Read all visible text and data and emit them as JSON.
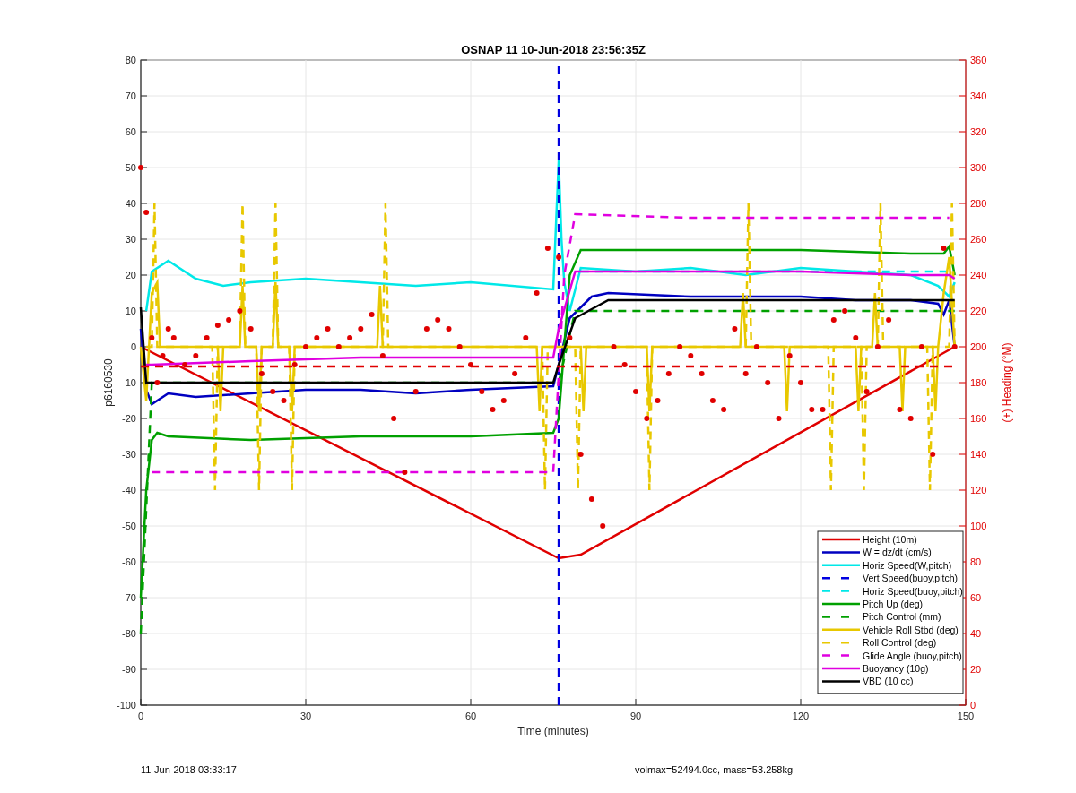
{
  "figure": {
    "chart_data": {
      "type": "line",
      "title": "OSNAP 11 10-Jun-2018 23:56:35Z",
      "xlabel": "Time (minutes)",
      "ylabel": "p6160530",
      "y2label": "(+) Heading (°M)",
      "grid": true,
      "legend": true,
      "xlim": [
        0,
        150
      ],
      "ylim": [
        -100,
        80
      ],
      "y2lim": [
        0,
        360
      ],
      "xticks": [
        0,
        30,
        60,
        90,
        120,
        150
      ],
      "yticks": [
        -100,
        -90,
        -80,
        -70,
        -60,
        -50,
        -40,
        -30,
        -20,
        -10,
        0,
        10,
        20,
        30,
        40,
        50,
        60,
        70,
        80
      ],
      "y2ticks": [
        0,
        20,
        40,
        60,
        80,
        100,
        120,
        140,
        160,
        180,
        200,
        220,
        240,
        260,
        280,
        300,
        320,
        340,
        360
      ],
      "series": [
        {
          "name": "Height (10m)",
          "color": "#e00000",
          "line_style": "solid",
          "x": [
            0,
            76,
            80,
            148
          ],
          "values": [
            0,
            -59,
            -58,
            0
          ]
        },
        {
          "name": "W = dz/dt (cm/s)",
          "color": "#0000c0",
          "line_style": "solid",
          "x": [
            0,
            1,
            2,
            5,
            10,
            20,
            30,
            40,
            50,
            60,
            75,
            76,
            78,
            82,
            85,
            100,
            120,
            130,
            140,
            145,
            146,
            147,
            148
          ],
          "values": [
            5,
            -12,
            -16,
            -13,
            -14,
            -13,
            -12,
            -12,
            -13,
            -12,
            -11,
            -5,
            8,
            14,
            15,
            14,
            14,
            13,
            13,
            12,
            9,
            13,
            0
          ]
        },
        {
          "name": "Horiz Speed(W,pitch)",
          "color": "#00e8e8",
          "line_style": "solid",
          "x": [
            1,
            2,
            5,
            10,
            15,
            20,
            30,
            40,
            50,
            60,
            75,
            76,
            76.5,
            77,
            78,
            80,
            90,
            100,
            110,
            120,
            130,
            140,
            145,
            147,
            148
          ],
          "values": [
            10,
            21,
            24,
            19,
            17,
            18,
            19,
            18,
            17,
            18,
            16,
            52,
            30,
            18,
            10,
            22,
            21,
            22,
            20,
            22,
            21,
            20,
            17,
            14,
            18
          ]
        },
        {
          "name": "Vert Speed(buoy,pitch)",
          "color": "#0000e0",
          "line_style": "dashed",
          "x": [
            76,
            76
          ],
          "values": [
            -100,
            80
          ]
        },
        {
          "name": "Horiz Speed(buoy,pitch)",
          "color": "#00e8e8",
          "line_style": "dashed",
          "x": [
            80,
            147
          ],
          "values": [
            21,
            21
          ]
        },
        {
          "name": "Pitch Up (deg)",
          "color": "#00a000",
          "line_style": "solid",
          "x": [
            0,
            1,
            2,
            3,
            5,
            20,
            40,
            60,
            75,
            76,
            78,
            80,
            90,
            100,
            120,
            140,
            146,
            147,
            148
          ],
          "values": [
            -70,
            -40,
            -26,
            -24,
            -25,
            -26,
            -25,
            -25,
            -24,
            -20,
            20,
            27,
            27,
            27,
            27,
            26,
            26,
            28,
            20
          ]
        },
        {
          "name": "Pitch Control (mm)",
          "color": "#00a000",
          "line_style": "dashed",
          "x": [
            0,
            2,
            75,
            76,
            79,
            147,
            148
          ],
          "values": [
            -80,
            -10,
            -10,
            -10,
            10,
            10,
            10
          ]
        },
        {
          "name": "Vehicle Roll Stbd (deg)",
          "color": "#e8c800",
          "line_style": "solid",
          "x": [
            0,
            1,
            2,
            3,
            3.5,
            4,
            10,
            14,
            14.5,
            15,
            18,
            18.5,
            19,
            21,
            21.5,
            22,
            24,
            24.5,
            25,
            27,
            27.5,
            28,
            43,
            43.5,
            44,
            50,
            70,
            72,
            72.5,
            73,
            76,
            78,
            80,
            80.5,
            81,
            86,
            86.5,
            87,
            92,
            92.5,
            93,
            109,
            109.5,
            110,
            117,
            117.5,
            118,
            130,
            130.5,
            131,
            133,
            133.5,
            134,
            138,
            138.5,
            139,
            144,
            144.5,
            145,
            146,
            147,
            148
          ],
          "values": [
            0,
            -15,
            15,
            18,
            0,
            0,
            0,
            0,
            -18,
            0,
            0,
            17,
            0,
            0,
            -18,
            0,
            0,
            18,
            0,
            0,
            -18,
            0,
            0,
            17,
            0,
            0,
            0,
            0,
            -18,
            0,
            0,
            0,
            0,
            -18,
            0,
            0,
            0,
            0,
            0,
            -18,
            0,
            0,
            15,
            0,
            0,
            -18,
            0,
            0,
            -18,
            0,
            0,
            15,
            0,
            0,
            -18,
            0,
            0,
            -18,
            0,
            15,
            25,
            0
          ]
        },
        {
          "name": "Roll Control (deg)",
          "color": "#e8c800",
          "line_style": "dashed",
          "x": [
            1,
            2,
            2.5,
            3,
            13,
            13.5,
            14,
            18,
            18.5,
            19,
            21,
            21.5,
            22,
            24,
            24.5,
            25,
            27,
            27.5,
            28,
            44,
            44.5,
            45,
            73,
            73.5,
            74,
            79,
            79.5,
            80,
            92,
            92.5,
            93,
            110,
            110.5,
            111,
            125,
            125.5,
            126,
            131,
            131.5,
            132,
            134,
            134.5,
            135,
            143,
            143.5,
            144,
            147,
            147.5,
            148
          ],
          "values": [
            0,
            0,
            40,
            0,
            0,
            -40,
            0,
            0,
            40,
            0,
            0,
            -40,
            0,
            0,
            40,
            0,
            0,
            -40,
            0,
            0,
            40,
            0,
            0,
            -40,
            0,
            0,
            -40,
            0,
            0,
            -40,
            0,
            0,
            40,
            0,
            0,
            -40,
            0,
            0,
            -40,
            0,
            0,
            40,
            0,
            0,
            -40,
            0,
            0,
            40,
            0
          ]
        },
        {
          "name": "Glide Angle (buoy,pitch)",
          "color": "#e000e0",
          "line_style": "dashed",
          "x": [
            2,
            20,
            40,
            60,
            75,
            77,
            79,
            100,
            120,
            140,
            147
          ],
          "values": [
            -35,
            -35,
            -35,
            -35,
            -35,
            20,
            37,
            36,
            36,
            36,
            36
          ]
        },
        {
          "name": "Buoyancy (10g)",
          "color": "#e000e0",
          "line_style": "solid",
          "x": [
            1,
            2,
            20,
            40,
            60,
            75,
            76,
            79,
            100,
            120,
            140,
            147,
            148
          ],
          "values": [
            -5,
            -5,
            -4,
            -3,
            -3,
            -3,
            5,
            21,
            21,
            21,
            20,
            20,
            19
          ]
        },
        {
          "name": "VBD (10 cc)",
          "color": "#000000",
          "line_style": "solid",
          "x": [
            0,
            1,
            75,
            76,
            79,
            85,
            100,
            148
          ],
          "values": [
            11,
            -10,
            -10,
            -5,
            8,
            13,
            13,
            13
          ]
        },
        {
          "color": "#e00000",
          "line_style": "dashed",
          "x": [
            0,
            148
          ],
          "values": [
            -5.5,
            -5.5
          ]
        },
        {
          "color": "#e00000",
          "type": "scatter",
          "axis": "y2",
          "x": [
            0,
            1,
            2,
            3,
            4,
            5,
            6,
            8,
            10,
            12,
            14,
            16,
            18,
            20,
            22,
            24,
            26,
            28,
            30,
            32,
            34,
            36,
            38,
            40,
            42,
            44,
            46,
            48,
            50,
            52,
            54,
            56,
            58,
            60,
            62,
            64,
            66,
            68,
            70,
            72,
            74,
            76,
            78,
            80,
            82,
            84,
            86,
            88,
            90,
            92,
            94,
            96,
            98,
            100,
            102,
            104,
            106,
            108,
            110,
            112,
            114,
            116,
            118,
            120,
            122,
            124,
            126,
            128,
            130,
            132,
            134,
            136,
            138,
            140,
            142,
            144,
            146,
            148
          ],
          "values": [
            300,
            275,
            205,
            180,
            195,
            210,
            205,
            190,
            195,
            205,
            212,
            215,
            220,
            210,
            185,
            175,
            170,
            190,
            200,
            205,
            210,
            200,
            205,
            210,
            218,
            195,
            160,
            130,
            175,
            210,
            215,
            210,
            200,
            190,
            175,
            165,
            170,
            185,
            205,
            230,
            255,
            250,
            205,
            140,
            115,
            100,
            200,
            190,
            175,
            160,
            170,
            185,
            200,
            195,
            185,
            170,
            165,
            210,
            185,
            200,
            180,
            160,
            195,
            180,
            165,
            165,
            215,
            220,
            205,
            175,
            200,
            215,
            165,
            160,
            200,
            140,
            255,
            200
          ]
        }
      ]
    }
  },
  "footer_left": "11-Jun-2018 03:33:17",
  "footer_right": "volmax=52494.0cc, mass=53.258kg"
}
